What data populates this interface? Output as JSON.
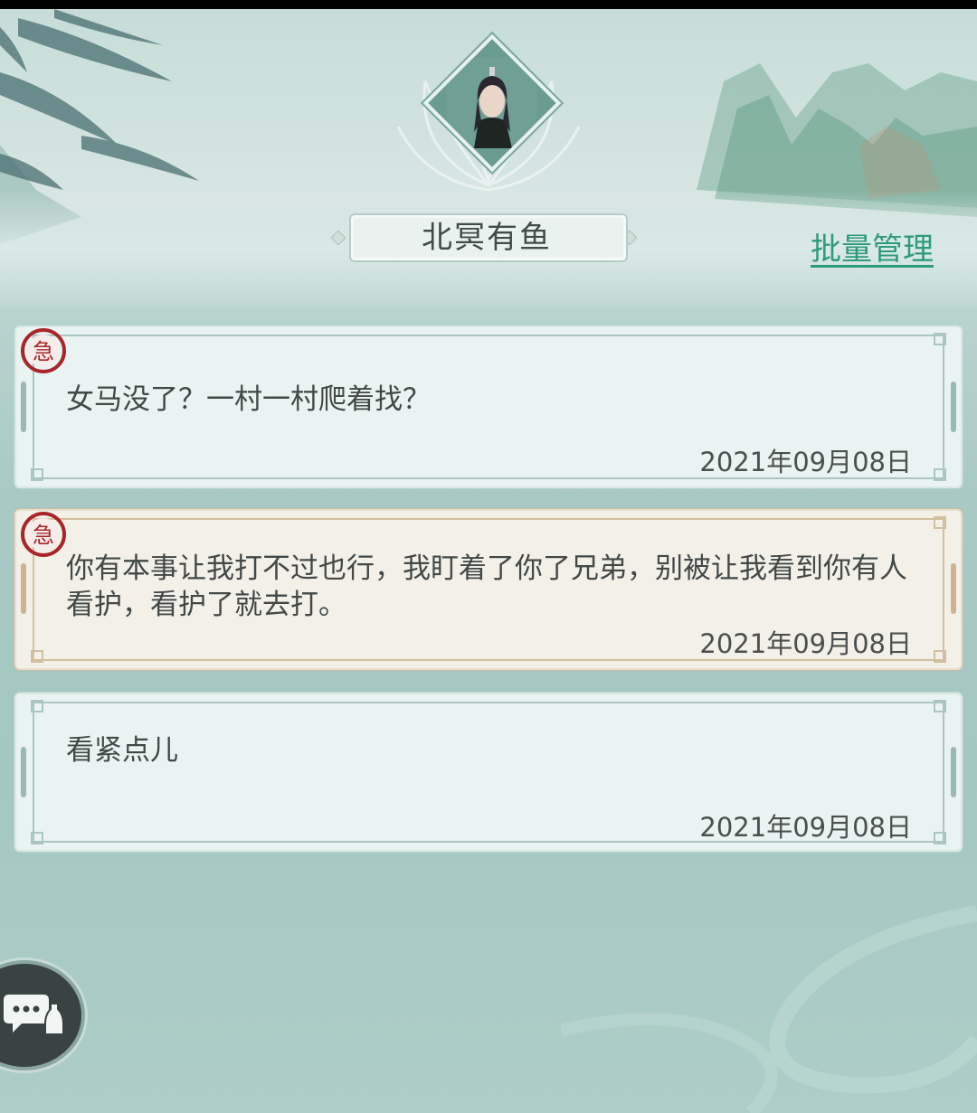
{
  "contact": {
    "name": "北冥有鱼"
  },
  "header": {
    "batch_manage_label": "批量管理"
  },
  "messages": [
    {
      "urgent": true,
      "urgent_glyph": "急",
      "style": "normal",
      "text": "女马没了？一村一村爬着找？",
      "date": "2021年09月08日"
    },
    {
      "urgent": true,
      "urgent_glyph": "急",
      "style": "beige",
      "text": "你有本事让我打不过也行，我盯着了你了兄弟，别被让我看到你有人看护，看护了就去打。",
      "date": "2021年09月08日"
    },
    {
      "urgent": false,
      "style": "normal",
      "text": "看紧点儿",
      "date": "2021年09月08日"
    }
  ],
  "colors": {
    "accent_link": "#2f9a7a",
    "urgent_seal": "#a8262a",
    "card_normal": "#e9f3f1",
    "card_beige": "#f3f0e8"
  },
  "icons": {
    "chat": "chat-bubble-with-bottle-icon",
    "urgent": "urgent-seal-icon"
  }
}
